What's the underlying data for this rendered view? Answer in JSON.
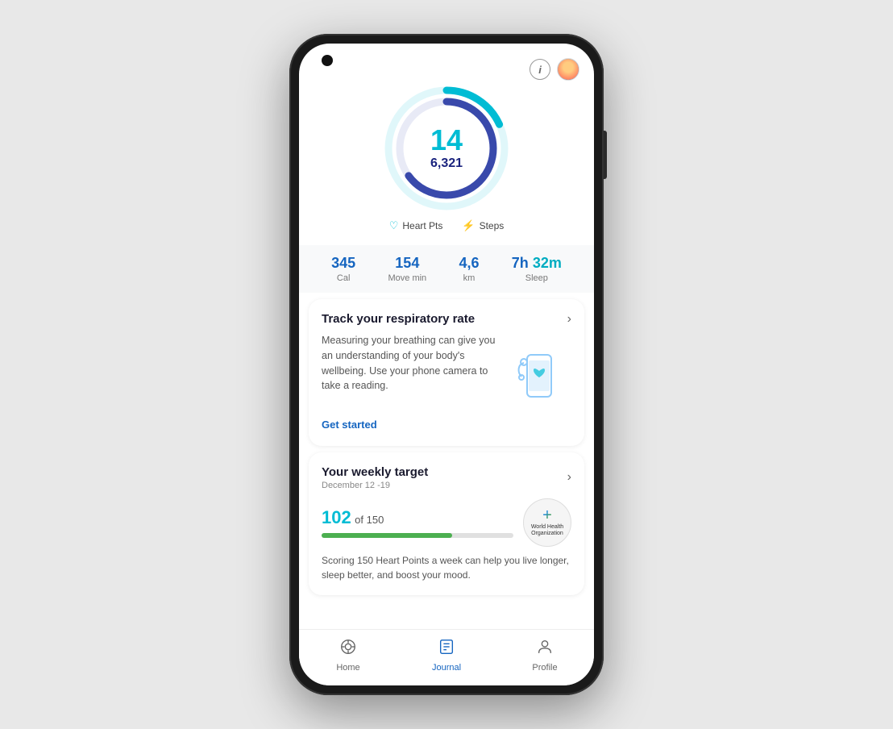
{
  "phone": {
    "header": {
      "info_label": "i",
      "avatar_alt": "User avatar"
    },
    "ring": {
      "heart_pts": "14",
      "steps": "6,321",
      "heart_pts_label": "Heart Pts",
      "steps_label": "Steps",
      "outer_ring_color": "#00bcd4",
      "inner_ring_color": "#3949ab",
      "outer_pct": 0.18,
      "inner_pct": 0.65
    },
    "stats": [
      {
        "value": "345",
        "label": "Cal",
        "color": "#1565c0"
      },
      {
        "value": "154",
        "label": "Move min",
        "color": "#1565c0"
      },
      {
        "value": "4,6",
        "label": "km",
        "color": "#1565c0"
      },
      {
        "value": "7h 32m",
        "label": "Sleep",
        "color_base": "#1565c0",
        "highlight": "32m",
        "highlight_color": "#00acc1"
      }
    ],
    "respiratory_card": {
      "title": "Track your respiratory rate",
      "body": "Measuring your breathing can give you an understanding of your body's wellbeing. Use your phone camera to take a reading.",
      "cta": "Get started"
    },
    "weekly_target_card": {
      "title": "Your weekly target",
      "date_range": "December 12 -19",
      "current": "102",
      "total": "150",
      "of_label": "of 150",
      "progress_pct": 68,
      "body_text": "Scoring 150 Heart Points a week can help you live longer, sleep better, and boost your mood.",
      "who_plus": "+",
      "who_label": "World Health\nOrganization"
    },
    "bottom_nav": [
      {
        "key": "home",
        "icon": "⏱",
        "label": "Home",
        "active": false
      },
      {
        "key": "journal",
        "icon": "📋",
        "label": "Journal",
        "active": true
      },
      {
        "key": "profile",
        "icon": "👤",
        "label": "Profile",
        "active": false
      }
    ]
  }
}
